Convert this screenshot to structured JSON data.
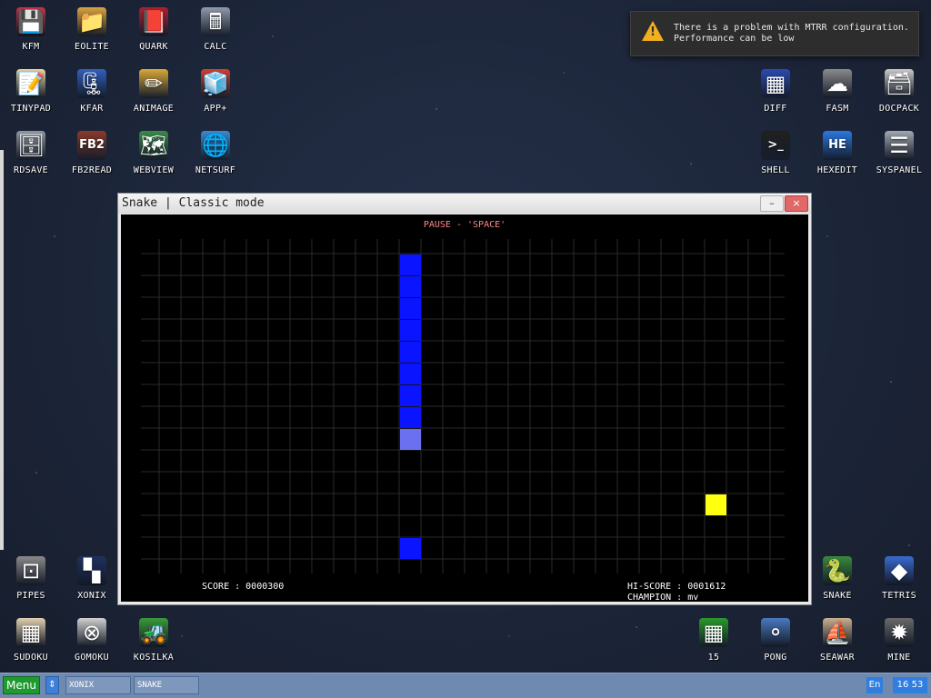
{
  "desktop": {
    "icons_top_left": [
      {
        "label": "KFM",
        "icon": "floppy-icon",
        "glyph": "💾",
        "color": "#c8324a"
      },
      {
        "label": "EOLITE",
        "icon": "folder-icon",
        "glyph": "📁",
        "color": "#d9a441"
      },
      {
        "label": "QUARK",
        "icon": "book-icon",
        "glyph": "📕",
        "color": "#b02030"
      },
      {
        "label": "CALC",
        "icon": "calculator-icon",
        "glyph": "🖩",
        "color": "#909aa8"
      },
      {
        "label": "TINYPAD",
        "icon": "notepad-icon",
        "glyph": "📝",
        "color": "#e8d8a8"
      },
      {
        "label": "KFAR",
        "icon": "archive-icon",
        "glyph": "🗜",
        "color": "#3060c0"
      },
      {
        "label": "ANIMAGE",
        "icon": "pencil-ruler-icon",
        "glyph": "✏",
        "color": "#d8a838"
      },
      {
        "label": "APP+",
        "icon": "rubik-cube-icon",
        "glyph": "🧊",
        "color": "#d04030"
      },
      {
        "label": "RDSAVE",
        "icon": "ramdisk-save-icon",
        "glyph": "🗄",
        "color": "#9098a0"
      },
      {
        "label": "FB2READ",
        "icon": "fb2-book-icon",
        "glyph": "FB2",
        "color": "#8a3a2a"
      },
      {
        "label": "WEBVIEW",
        "icon": "webview-icon",
        "glyph": "🗺",
        "color": "#3a8a4a"
      },
      {
        "label": "NETSURF",
        "icon": "globe-icon",
        "glyph": "🌐",
        "color": "#3a8ad0"
      }
    ],
    "icons_top_right": [
      {
        "label": "DIFF",
        "icon": "diff-icon",
        "glyph": "▦",
        "color": "#2a4ab0"
      },
      {
        "label": "FASM",
        "icon": "fasm-icon",
        "glyph": "☁",
        "color": "#8a8a8a"
      },
      {
        "label": "DOCPACK",
        "icon": "cabinet-icon",
        "glyph": "🗃",
        "color": "#c8c8c8"
      },
      {
        "label": "SHELL",
        "icon": "terminal-icon",
        "glyph": ">_",
        "color": "#202020"
      },
      {
        "label": "HEXEDIT",
        "icon": "hexedit-icon",
        "glyph": "HE",
        "color": "#2a78e0"
      },
      {
        "label": "SYSPANEL",
        "icon": "sliders-icon",
        "glyph": "☰",
        "color": "#a0a8b0"
      }
    ],
    "icons_bottom_left": [
      {
        "label": "PIPES",
        "icon": "pipes-icon",
        "glyph": "⊡",
        "color": "#8a8a8a"
      },
      {
        "label": "XONIX",
        "icon": "xonix-icon",
        "glyph": "▚",
        "color": "#203060"
      },
      {
        "label": "SUDOKU",
        "icon": "sudoku-icon",
        "glyph": "▦",
        "color": "#e0d0b0"
      },
      {
        "label": "GOMOKU",
        "icon": "gomoku-icon",
        "glyph": "⊗",
        "color": "#d0d0d0"
      },
      {
        "label": "KOSILKA",
        "icon": "lawnmower-icon",
        "glyph": "🚜",
        "color": "#3a9a3a"
      }
    ],
    "icons_bottom_right": [
      {
        "label": "SNAKE",
        "icon": "snake-icon",
        "glyph": "🐍",
        "color": "#3a8a3a"
      },
      {
        "label": "TETRIS",
        "icon": "tetris-icon",
        "glyph": "◆",
        "color": "#3a6ad0"
      },
      {
        "label": "15",
        "icon": "fifteen-puzzle-icon",
        "glyph": "▦",
        "color": "#2a9a2a"
      },
      {
        "label": "PONG",
        "icon": "pong-icon",
        "glyph": "⚬",
        "color": "#4a78c0"
      },
      {
        "label": "SEAWAR",
        "icon": "seawar-icon",
        "glyph": "⛵",
        "color": "#c8b090"
      },
      {
        "label": "MINE",
        "icon": "mine-icon",
        "glyph": "✹",
        "color": "#6a6a6a"
      }
    ]
  },
  "notification": {
    "icon": "warning-icon",
    "line1": "There is a problem with MTRR configuration.",
    "line2": "Performance can be low"
  },
  "window": {
    "title": "Snake | Classic mode",
    "min_glyph": "–",
    "close_glyph": "×"
  },
  "game": {
    "pause_text": "PAUSE - 'SPACE'",
    "score_text": "SCORE : 0000300",
    "hiscore_text": "HI-SCORE : 0001612",
    "champion_text": "CHAMPION : mv",
    "grid": {
      "cols": 29,
      "rows": 14
    },
    "colors": {
      "grid": "#2a2a2a",
      "snake_body": "#0a14ff",
      "snake_head": "#6a70f0",
      "food": "#ffff10",
      "background": "#000000"
    },
    "snake_cells": [
      [
        11,
        0
      ],
      [
        11,
        1
      ],
      [
        11,
        2
      ],
      [
        11,
        3
      ],
      [
        11,
        4
      ],
      [
        11,
        5
      ],
      [
        11,
        6
      ],
      [
        11,
        7
      ]
    ],
    "head_cell": [
      11,
      8
    ],
    "tail_cells": [
      [
        11,
        13
      ]
    ],
    "food_cell": [
      25,
      11
    ]
  },
  "taskbar": {
    "menu_label": "Menu",
    "arrows_glyph": "⇕",
    "tasks": [
      "XONIX",
      "SNAKE"
    ],
    "lang": "En",
    "clock": "16 53"
  }
}
